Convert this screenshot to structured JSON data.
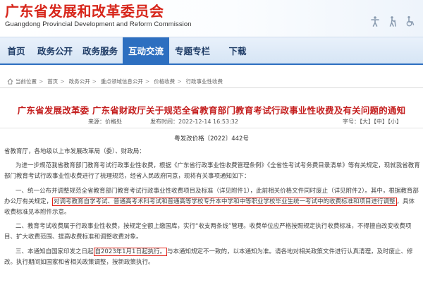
{
  "header": {
    "site_name_cn": "广东省发展和改革委员会",
    "site_name_en": "Guangdong Provincial Development and Reform Commission",
    "tools": [
      "accessibility-person-icon",
      "elderly-icon",
      "wheelchair-icon"
    ]
  },
  "nav": {
    "items": [
      {
        "label": "首页",
        "active": false
      },
      {
        "label": "政务公开",
        "active": false
      },
      {
        "label": "政务服务",
        "active": false
      },
      {
        "label": "互动交流",
        "active": true
      },
      {
        "label": "专题专栏",
        "active": false
      },
      {
        "label": "下载",
        "active": false
      }
    ]
  },
  "breadcrumb": {
    "items": [
      "当前位置",
      "首页",
      "政务公开",
      "重点领域信息公开",
      "价格收费",
      "行政事业性收费"
    ]
  },
  "article": {
    "title": "广东省发展改革委 广东省财政厅关于规范全省教育部门教育考试行政事业性收费及有关问题的通知",
    "source": "来源：价格处",
    "date": "发布时间：2022-12-14 16:53:32",
    "font_size": "字号：【大】【中】【小】",
    "doc_number": "粤发改价格〔2022〕442号",
    "salutation": "省教育厅，各地级以上市发展改革局（委）、财政局：",
    "p1": "为进一步规范我省教育部门教育考试行政事业性收费，根据《广东省行政事业性收费管理条例》《全省性考试考务费目录清单》等有关规定，现就我省教育部门教育考试行政事业性收费进行了梳理规范，经省人民政府同意，现将有关事项通知如下：",
    "p2_start": "一、统一公布并调整规范全省教育部门教育考试行政事业性收费项目及标准（详见附件1），此前相关价格文件同时废止（详见附件2）。其中，根据教育部",
    "p2_mid_pre": "办公厅有关规定，",
    "p2_highlight": "对调考教育自学考试、普通高考术科考试和普通高等学校专升本中学和中等职业学校毕业生统一考试中的收费标准和项目进行调整",
    "p2_end": "，具体收费标准见本附件示意。",
    "p3": "二、教育考试收费属于行政事业性收费，按规定全额上缴国库，实行“收支两条线”管理。收费单位应严格按照规定执行收费标准，不得擅自改变收费项目、扩大收费范围、提高收费标准和调整收费对象。",
    "p4_start": "三、本通知自国家印发之日起",
    "p4_highlight": "自2023年1月1日起执行。",
    "p4_end": "与本通知规定不一致的，以本通知为准。请各地对相关政策文件进行认真清理，及时废止、修改。执行期间如国家和省相关政策调整，按新政策执行。"
  }
}
